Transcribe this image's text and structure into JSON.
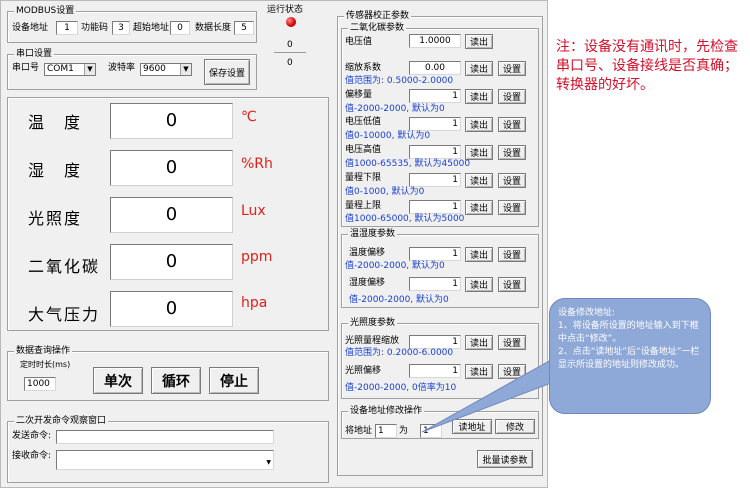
{
  "modbus": {
    "title": "MODBUS设置",
    "device_addr_label": "设备地址",
    "device_addr": "1",
    "func_code_label": "功能码",
    "func_code": "3",
    "start_addr_label": "超始地址",
    "start_addr": "0",
    "data_len_label": "数据长度",
    "data_len": "5"
  },
  "run_status": {
    "title": "运行状态",
    "value1": "0",
    "value2": "0"
  },
  "serial": {
    "title": "串口设置",
    "port_label": "串口号",
    "port_value": "COM1",
    "baud_label": "波特率",
    "baud_value": "9600",
    "save_label": "保存设置"
  },
  "sensors": [
    {
      "name": "温　度",
      "value": "0",
      "unit": "℃"
    },
    {
      "name": "湿　度",
      "value": "0",
      "unit": "%Rh"
    },
    {
      "name": "光照度",
      "value": "0",
      "unit": "Lux"
    },
    {
      "name": "二氧化碳",
      "value": "0",
      "unit": "ppm"
    },
    {
      "name": "大气压力",
      "value": "0",
      "unit": "hpa"
    }
  ],
  "query": {
    "title": "数据查询操作",
    "timer_label": "定时时长(ms)",
    "timer_value": "1000",
    "single_label": "单次",
    "loop_label": "循环",
    "stop_label": "停止"
  },
  "dev_window": {
    "title": "二次开发命令观察窗口",
    "send_label": "发送命令:",
    "recv_label": "接收命令:"
  },
  "calib": {
    "title": "传感器校正参数",
    "read_label": "读出",
    "set_label": "设置",
    "co2": {
      "title": "二氧化碳参数",
      "voltage_label": "电压值",
      "voltage_value": "1.0000",
      "scale_label": "缩放系数",
      "scale_value": "0.00",
      "scale_hint": "值范围为: 0.5000-2.0000",
      "offset_label": "偏移量",
      "offset_value": "1",
      "offset_hint": "值-2000-2000, 默认为0",
      "vlow_label": "电压低值",
      "vlow_value": "1",
      "vlow_hint": "值0-10000, 默认为0",
      "vhigh_label": "电压高值",
      "vhigh_value": "1",
      "vhigh_hint": "值1000-65535, 默认为45000",
      "rlow_label": "量程下限",
      "rlow_value": "1",
      "rlow_hint": "值0-1000, 默认为0",
      "rhigh_label": "量程上限",
      "rhigh_value": "1",
      "rhigh_hint": "值1000-65000, 默认为5000"
    },
    "th": {
      "title": "温湿度参数",
      "temp_label": "温度偏移",
      "temp_value": "1",
      "temp_hint": "值-2000-2000, 默认为0",
      "hum_label": "湿度偏移",
      "hum_value": "1",
      "hum_hint": "值-2000-2000, 默认为0"
    },
    "light": {
      "title": "光照度参数",
      "scale_label": "光照量程缩放",
      "scale_value": "1",
      "scale_hint": "值范围为: 0.2000-6.0000",
      "offset_label": "光照偏移",
      "offset_value": "1",
      "offset_hint": "值-2000-2000, 0倍率为10"
    },
    "addr": {
      "title": "设备地址修改操作",
      "from_label": "将地址",
      "from_value": "1",
      "to_label": "为",
      "to_value": "1",
      "read_addr_label": "读地址",
      "modify_label": "修改"
    },
    "batch_label": "批量读参数"
  },
  "note": "注：设备没有通讯时，先检查串口号、设备接线是否真确；转换器的好坏。",
  "callout": {
    "title": "设备修改地址:",
    "line1": "1、将设备所设置的地址输入到下框中点击“修改”。",
    "line2": "2、点击“读地址”后“设备地址”一栏显示所设置的地址则修改成功。"
  }
}
